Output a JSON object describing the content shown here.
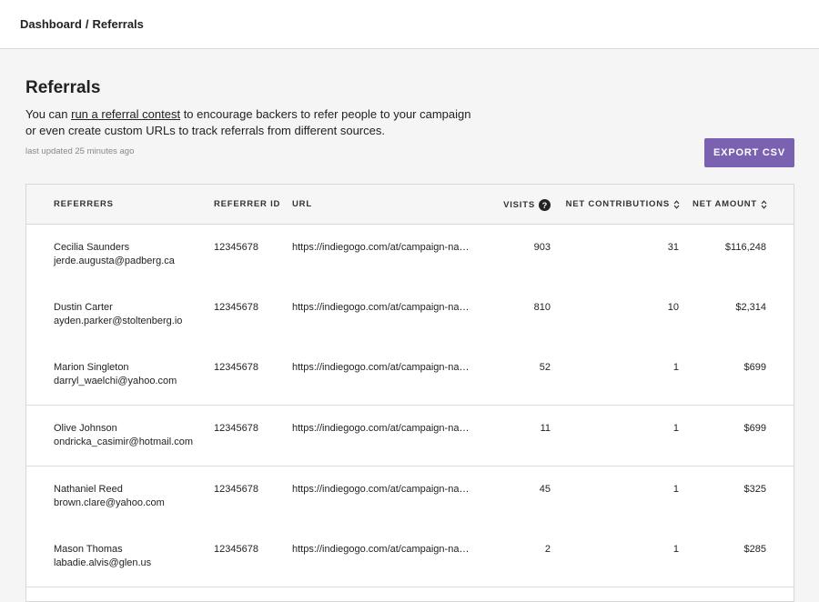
{
  "breadcrumb": {
    "items": [
      "Dashboard",
      "Referrals"
    ],
    "separator": "/"
  },
  "page": {
    "title": "Referrals",
    "description_prefix": "You can ",
    "description_link": "run a referral contest",
    "description_suffix": " to encourage backers to refer people to your campaign or even create custom URLs to track referrals from different sources.",
    "last_updated": "last updated 25 minutes ago",
    "export_label": "EXPORT CSV"
  },
  "colors": {
    "accent": "#7a62b0"
  },
  "table": {
    "headers": {
      "referrers": "REFERRERS",
      "referrer_id": "REFERRER ID",
      "url": "URL",
      "visits": "VISITS",
      "visits_help_icon": "?",
      "net_contributions": "NET CONTRIBUTIONS",
      "net_amount": "NET AMOUNT"
    },
    "rows": [
      {
        "name": "Cecilia Saunders",
        "email": "jerde.augusta@padberg.ca",
        "id": "12345678",
        "url": "https://indiegogo.com/at/campaign-na…",
        "visits": "903",
        "contributions": "31",
        "amount": "$116,248"
      },
      {
        "name": "Dustin Carter",
        "email": "ayden.parker@stoltenberg.io",
        "id": "12345678",
        "url": "https://indiegogo.com/at/campaign-na…",
        "visits": "810",
        "contributions": "10",
        "amount": "$2,314"
      },
      {
        "name": "Marion Singleton",
        "email": "darryl_waelchi@yahoo.com",
        "id": "12345678",
        "url": "https://indiegogo.com/at/campaign-na…",
        "visits": "52",
        "contributions": "1",
        "amount": "$699"
      },
      {
        "name": "Olive Johnson",
        "email": "ondricka_casimir@hotmail.com",
        "id": "12345678",
        "url": "https://indiegogo.com/at/campaign-na…",
        "visits": "11",
        "contributions": "1",
        "amount": "$699"
      },
      {
        "name": "Nathaniel Reed",
        "email": "brown.clare@yahoo.com",
        "id": "12345678",
        "url": "https://indiegogo.com/at/campaign-na…",
        "visits": "45",
        "contributions": "1",
        "amount": "$325"
      },
      {
        "name": "Mason Thomas",
        "email": "labadie.alvis@glen.us",
        "id": "12345678",
        "url": "https://indiegogo.com/at/campaign-na…",
        "visits": "2",
        "contributions": "1",
        "amount": "$285"
      }
    ]
  }
}
